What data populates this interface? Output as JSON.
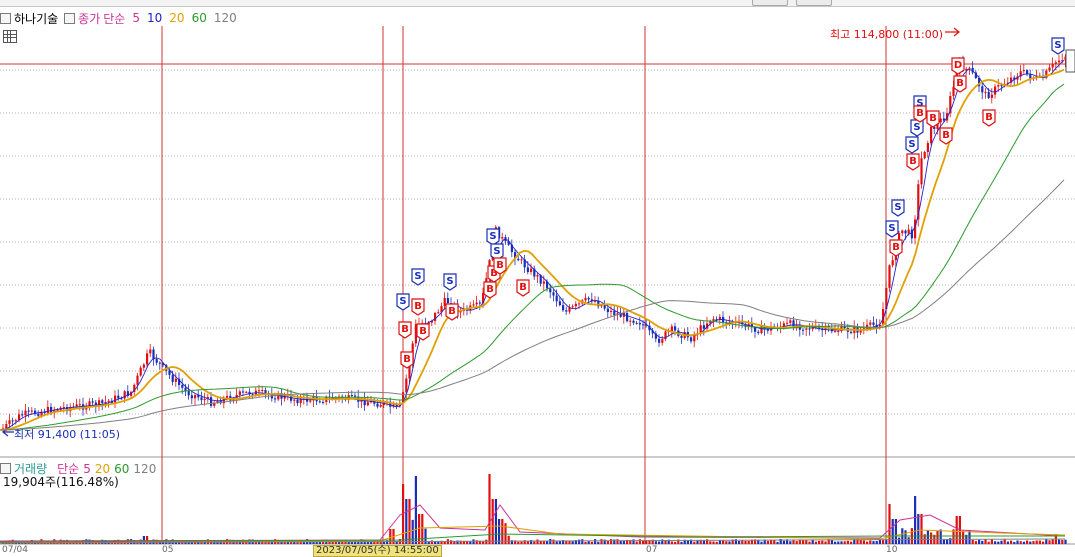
{
  "toolbar": {
    "buttons": [
      "",
      ""
    ]
  },
  "price_legend": {
    "indicator_name": "하나기술",
    "chart_type": "종가",
    "ma_type": "단순",
    "periods": [
      "5",
      "10",
      "20",
      "60",
      "120"
    ],
    "colors": [
      "#cc3399",
      "#2222cc",
      "#e0a000",
      "#2c9a2c",
      "#808080"
    ]
  },
  "volume_legend": {
    "indicator_name": "거래량",
    "ma_type": "단순",
    "periods": [
      "5",
      "20",
      "60",
      "120"
    ],
    "colors": [
      "#cc3399",
      "#e0a000",
      "#2c9a2c",
      "#808080"
    ],
    "info": "19,904주(116.48%)"
  },
  "annotations": {
    "high": "최고 114,800 (11:00)",
    "low": "최저 91,400 (11:05)"
  },
  "x_axis": {
    "labels": [
      "07/04",
      "05",
      "07",
      "10"
    ],
    "crosshair_date": "2023/07/05(수) 14:55:00"
  },
  "signals": {
    "buy": "B",
    "sell": "S"
  },
  "colors": {
    "up": "#e01010",
    "down": "#1a2eb8",
    "vline": "#d63333",
    "hline": "#d63333",
    "grid": "#b4b4b4"
  }
}
